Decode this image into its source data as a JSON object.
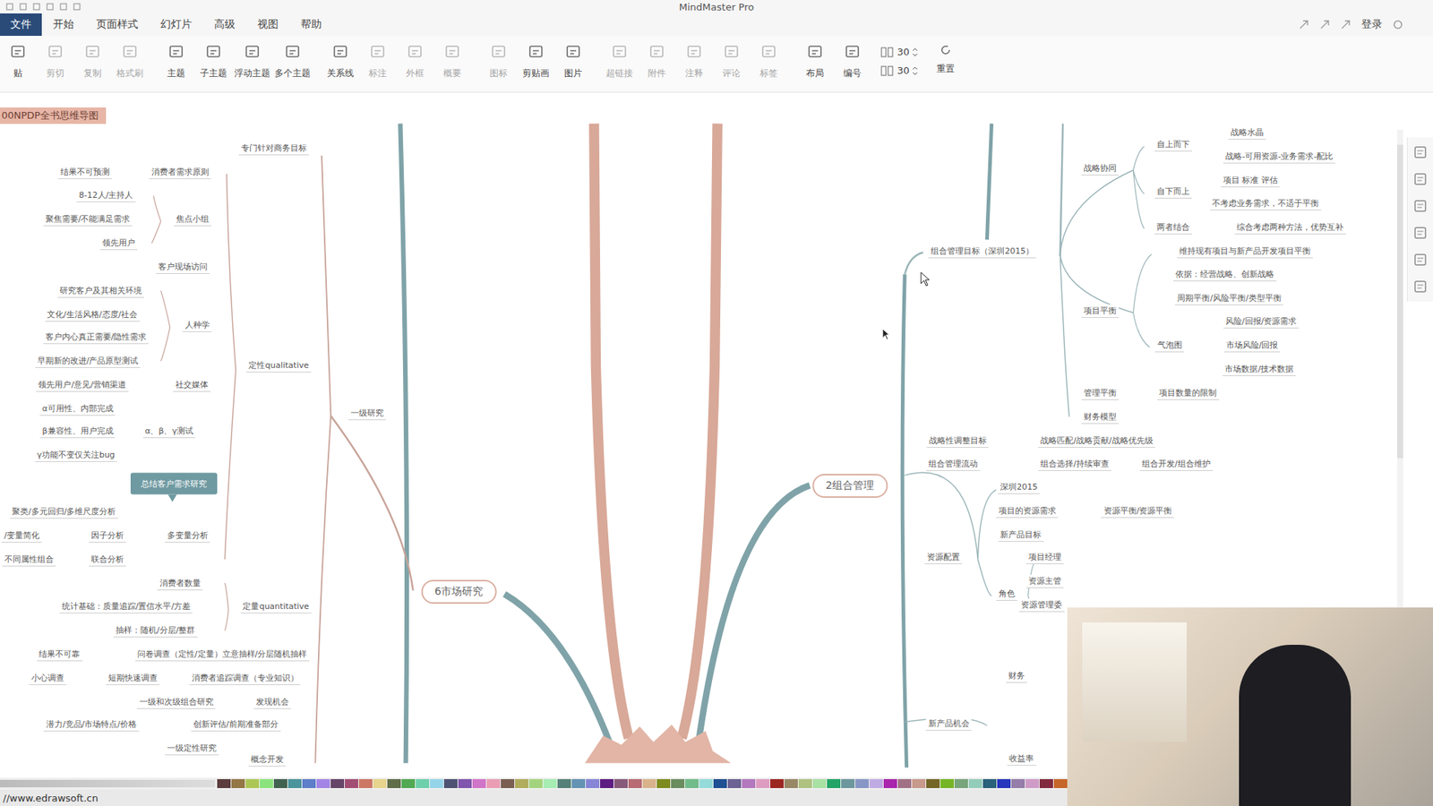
{
  "window": {
    "title": "MindMaster Pro"
  },
  "menu": [
    {
      "label": "文件",
      "selected": true
    },
    {
      "label": "开始",
      "selected": false
    },
    {
      "label": "页面样式",
      "selected": false
    },
    {
      "label": "幻灯片",
      "selected": false
    },
    {
      "label": "高级",
      "selected": false
    },
    {
      "label": "视图",
      "selected": false
    },
    {
      "label": "帮助",
      "selected": false
    }
  ],
  "account": {
    "label": "登录"
  },
  "toolbar": [
    {
      "label": "贴",
      "disabled": false
    },
    {
      "label": "剪切",
      "disabled": true
    },
    {
      "label": "复制",
      "disabled": true
    },
    {
      "label": "格式刷",
      "disabled": true
    },
    {
      "label": "主题",
      "disabled": false
    },
    {
      "label": "子主题",
      "disabled": false
    },
    {
      "label": "浮动主题",
      "disabled": false
    },
    {
      "label": "多个主题",
      "disabled": false
    },
    {
      "label": "关系线",
      "disabled": false
    },
    {
      "label": "标注",
      "disabled": true
    },
    {
      "label": "外框",
      "disabled": true
    },
    {
      "label": "概要",
      "disabled": true
    },
    {
      "label": "图标",
      "disabled": true
    },
    {
      "label": "剪贴画",
      "disabled": false
    },
    {
      "label": "图片",
      "disabled": false
    },
    {
      "label": "超链接",
      "disabled": true
    },
    {
      "label": "附件",
      "disabled": true
    },
    {
      "label": "注释",
      "disabled": true
    },
    {
      "label": "评论",
      "disabled": true
    },
    {
      "label": "标签",
      "disabled": true
    },
    {
      "label": "布局",
      "disabled": false
    },
    {
      "label": "编号",
      "disabled": false
    }
  ],
  "spinners": [
    "30",
    "30"
  ],
  "reset": "重置",
  "document_tab": "00NPDP全书思维导图",
  "map": {
    "nodes": [
      {
        "text": "专门针对商务目标",
        "kind": "leaf"
      },
      {
        "text": "结果不可预测",
        "kind": "leaf"
      },
      {
        "text": "消费者需求原则",
        "kind": "leaf"
      },
      {
        "text": "8-12人/主持人",
        "kind": "leaf"
      },
      {
        "text": "焦点小组",
        "kind": "leaf"
      },
      {
        "text": "聚焦需要/不能满足需求",
        "kind": "leaf"
      },
      {
        "text": "领先用户",
        "kind": "leaf"
      },
      {
        "text": "客户现场访问",
        "kind": "leaf"
      },
      {
        "text": "研究客户及其相关环境",
        "kind": "leaf"
      },
      {
        "text": "文化/生活风格/态度/社会",
        "kind": "leaf"
      },
      {
        "text": "人种学",
        "kind": "leaf"
      },
      {
        "text": "客户内心真正需要/隐性需求",
        "kind": "leaf"
      },
      {
        "text": "早期新的改进/产品原型测试",
        "kind": "leaf"
      },
      {
        "text": "定性qualitative",
        "kind": "leaf"
      },
      {
        "text": "领先用户/意见/营销渠道",
        "kind": "leaf"
      },
      {
        "text": "社交媒体",
        "kind": "leaf"
      },
      {
        "text": "α可用性、内部完成",
        "kind": "leaf"
      },
      {
        "text": "β兼容性、用户完成",
        "kind": "leaf"
      },
      {
        "text": "α、β、γ测试",
        "kind": "leaf"
      },
      {
        "text": "γ功能不变仅关注bug",
        "kind": "leaf"
      },
      {
        "text": "一级研究",
        "kind": "leaf"
      },
      {
        "text": "总结客户需求研究",
        "kind": "callout"
      },
      {
        "text": "聚类/多元回归/多维尺度分析",
        "kind": "leaf"
      },
      {
        "text": "/变量简化",
        "kind": "leaf"
      },
      {
        "text": "因子分析",
        "kind": "leaf"
      },
      {
        "text": "多变量分析",
        "kind": "leaf"
      },
      {
        "text": "不同属性组合",
        "kind": "leaf"
      },
      {
        "text": "联合分析",
        "kind": "leaf"
      },
      {
        "text": "消费者数量",
        "kind": "leaf"
      },
      {
        "text": "统计基础：质量追踪/置信水平/方差",
        "kind": "leaf"
      },
      {
        "text": "定量quantitative",
        "kind": "leaf"
      },
      {
        "text": "抽样：随机/分层/整群",
        "kind": "leaf"
      },
      {
        "text": "结果不可靠",
        "kind": "leaf"
      },
      {
        "text": "问卷调查（定性/定量）立意抽样/分层随机抽样",
        "kind": "leaf"
      },
      {
        "text": "小心调查",
        "kind": "leaf"
      },
      {
        "text": "短期快速调查",
        "kind": "leaf"
      },
      {
        "text": "消费者追踪调查（专业知识）",
        "kind": "leaf"
      },
      {
        "text": "一级和次级组合研究",
        "kind": "leaf"
      },
      {
        "text": "发现机会",
        "kind": "leaf"
      },
      {
        "text": "潜力/竞品/市场特点/价格",
        "kind": "leaf"
      },
      {
        "text": "创新评估/前期准备部分",
        "kind": "leaf"
      },
      {
        "text": "一级定性研究",
        "kind": "leaf"
      },
      {
        "text": "概念开发",
        "kind": "leaf"
      },
      {
        "text": "6市场研究",
        "kind": "main"
      },
      {
        "text": "战略水晶",
        "kind": "leaf"
      },
      {
        "text": "自上而下",
        "kind": "leaf"
      },
      {
        "text": "战略-可用资源-业务需求-配比",
        "kind": "leaf"
      },
      {
        "text": "战略协同",
        "kind": "leaf"
      },
      {
        "text": "项目 标准 评估",
        "kind": "leaf"
      },
      {
        "text": "自下而上",
        "kind": "leaf"
      },
      {
        "text": "不考虑业务需求，不适于平衡",
        "kind": "leaf"
      },
      {
        "text": "两者结合",
        "kind": "leaf"
      },
      {
        "text": "综合考虑两种方法，优势互补",
        "kind": "leaf"
      },
      {
        "text": "组合管理目标（深圳2015）",
        "kind": "leaf"
      },
      {
        "text": "维持现有项目与新产品开发项目平衡",
        "kind": "leaf"
      },
      {
        "text": "依据：经营战略、创新战略",
        "kind": "leaf"
      },
      {
        "text": "周期平衡/风险平衡/类型平衡",
        "kind": "leaf"
      },
      {
        "text": "项目平衡",
        "kind": "leaf"
      },
      {
        "text": "风险/回报/资源需求",
        "kind": "leaf"
      },
      {
        "text": "气泡图",
        "kind": "leaf"
      },
      {
        "text": "市场风险/回报",
        "kind": "leaf"
      },
      {
        "text": "市场数据/技术数据",
        "kind": "leaf"
      },
      {
        "text": "管理平衡",
        "kind": "leaf"
      },
      {
        "text": "项目数量的限制",
        "kind": "leaf"
      },
      {
        "text": "财务模型",
        "kind": "leaf"
      },
      {
        "text": "战略性调整目标",
        "kind": "leaf"
      },
      {
        "text": "战略匹配/战略贡献/战略优先级",
        "kind": "leaf"
      },
      {
        "text": "组合管理流动",
        "kind": "leaf"
      },
      {
        "text": "组合选择/持续审查",
        "kind": "leaf"
      },
      {
        "text": "组合开发/组合维护",
        "kind": "leaf"
      },
      {
        "text": "2组合管理",
        "kind": "main"
      },
      {
        "text": "深圳2015",
        "kind": "leaf"
      },
      {
        "text": "项目的资源需求",
        "kind": "leaf"
      },
      {
        "text": "资源平衡/资源平衡",
        "kind": "leaf"
      },
      {
        "text": "新产品目标",
        "kind": "leaf"
      },
      {
        "text": "资源配置",
        "kind": "leaf"
      },
      {
        "text": "项目经理",
        "kind": "leaf"
      },
      {
        "text": "资源主管",
        "kind": "leaf"
      },
      {
        "text": "角色",
        "kind": "leaf"
      },
      {
        "text": "资源管理委",
        "kind": "leaf"
      },
      {
        "text": "财务",
        "kind": "leaf"
      },
      {
        "text": "新产品机会",
        "kind": "leaf"
      },
      {
        "text": "收益率",
        "kind": "leaf"
      }
    ]
  },
  "status_bar": {
    "url": "//www.edrawsoft.cn"
  }
}
